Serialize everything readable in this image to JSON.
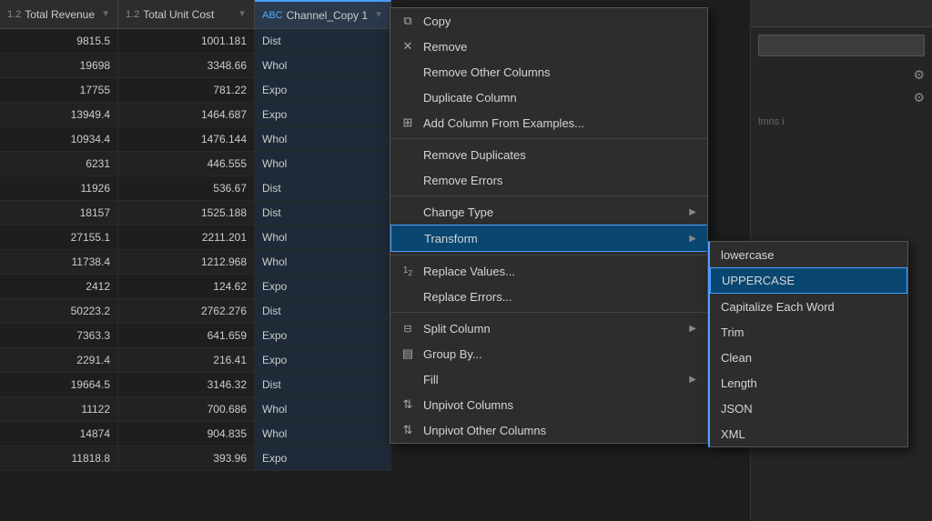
{
  "table": {
    "columns": [
      {
        "id": "revenue",
        "type": "1.2",
        "label": "Total Revenue",
        "icon": "▼"
      },
      {
        "id": "unitcost",
        "type": "1.2",
        "label": "Total Unit Cost",
        "icon": "▼"
      },
      {
        "id": "channel",
        "type": "ABC",
        "label": "Channel_Copy 1",
        "icon": "▼"
      }
    ],
    "rows": [
      {
        "revenue": "9815.5",
        "unitcost": "1001.181",
        "channel": "Dist"
      },
      {
        "revenue": "19698",
        "unitcost": "3348.66",
        "channel": "Whol"
      },
      {
        "revenue": "17755",
        "unitcost": "781.22",
        "channel": "Expo"
      },
      {
        "revenue": "13949.4",
        "unitcost": "1464.687",
        "channel": "Expo"
      },
      {
        "revenue": "10934.4",
        "unitcost": "1476.144",
        "channel": "Whol"
      },
      {
        "revenue": "6231",
        "unitcost": "446.555",
        "channel": "Whol"
      },
      {
        "revenue": "11926",
        "unitcost": "536.67",
        "channel": "Dist"
      },
      {
        "revenue": "18157",
        "unitcost": "1525.188",
        "channel": "Dist"
      },
      {
        "revenue": "27155.1",
        "unitcost": "2211.201",
        "channel": "Whol"
      },
      {
        "revenue": "11738.4",
        "unitcost": "1212.968",
        "channel": "Whol"
      },
      {
        "revenue": "2412",
        "unitcost": "124.62",
        "channel": "Expo"
      },
      {
        "revenue": "50223.2",
        "unitcost": "2762.276",
        "channel": "Dist"
      },
      {
        "revenue": "7363.3",
        "unitcost": "641.659",
        "channel": "Expo"
      },
      {
        "revenue": "2291.4",
        "unitcost": "216.41",
        "channel": "Expo"
      },
      {
        "revenue": "19664.5",
        "unitcost": "3146.32",
        "channel": "Dist"
      },
      {
        "revenue": "11122",
        "unitcost": "700.686",
        "channel": "Whol"
      },
      {
        "revenue": "14874",
        "unitcost": "904.835",
        "channel": "Whol"
      },
      {
        "revenue": "11818.8",
        "unitcost": "393.96",
        "channel": "Expo"
      }
    ]
  },
  "contextMenu": {
    "items": [
      {
        "id": "copy",
        "icon": "copy",
        "label": "Copy",
        "hasArrow": false,
        "hasSeparatorAfter": false
      },
      {
        "id": "remove",
        "icon": "remove",
        "label": "Remove",
        "hasArrow": false,
        "hasSeparatorAfter": false
      },
      {
        "id": "remove-other-columns",
        "icon": "",
        "label": "Remove Other Columns",
        "hasArrow": false,
        "hasSeparatorAfter": false
      },
      {
        "id": "duplicate-column",
        "icon": "",
        "label": "Duplicate Column",
        "hasArrow": false,
        "hasSeparatorAfter": false
      },
      {
        "id": "add-column-examples",
        "icon": "add-col",
        "label": "Add Column From Examples...",
        "hasArrow": false,
        "hasSeparatorAfter": true
      },
      {
        "id": "remove-duplicates",
        "icon": "",
        "label": "Remove Duplicates",
        "hasArrow": false,
        "hasSeparatorAfter": false
      },
      {
        "id": "remove-errors",
        "icon": "",
        "label": "Remove Errors",
        "hasArrow": false,
        "hasSeparatorAfter": true
      },
      {
        "id": "change-type",
        "icon": "",
        "label": "Change Type",
        "hasArrow": true,
        "hasSeparatorAfter": false
      },
      {
        "id": "transform",
        "icon": "",
        "label": "Transform",
        "hasArrow": true,
        "hasSeparatorAfter": true,
        "active": true
      },
      {
        "id": "replace-values",
        "icon": "replace",
        "label": "Replace Values...",
        "hasArrow": false,
        "hasSeparatorAfter": false
      },
      {
        "id": "replace-errors",
        "icon": "",
        "label": "Replace Errors...",
        "hasArrow": false,
        "hasSeparatorAfter": true
      },
      {
        "id": "split-column",
        "icon": "split",
        "label": "Split Column",
        "hasArrow": true,
        "hasSeparatorAfter": false
      },
      {
        "id": "group-by",
        "icon": "group",
        "label": "Group By...",
        "hasArrow": false,
        "hasSeparatorAfter": false
      },
      {
        "id": "fill",
        "icon": "",
        "label": "Fill",
        "hasArrow": true,
        "hasSeparatorAfter": false
      },
      {
        "id": "unpivot-columns",
        "icon": "unpivot",
        "label": "Unpivot Columns",
        "hasArrow": false,
        "hasSeparatorAfter": false
      },
      {
        "id": "unpivot-other-columns",
        "icon": "unpivot",
        "label": "Unpivot Other Columns",
        "hasArrow": false,
        "hasSeparatorAfter": false
      }
    ]
  },
  "submenu": {
    "items": [
      {
        "id": "lowercase",
        "label": "lowercase"
      },
      {
        "id": "uppercase",
        "label": "UPPERCASE",
        "selected": true
      },
      {
        "id": "capitalize",
        "label": "Capitalize Each Word"
      },
      {
        "id": "trim",
        "label": "Trim"
      },
      {
        "id": "clean",
        "label": "Clean"
      },
      {
        "id": "length",
        "label": "Length"
      },
      {
        "id": "json",
        "label": "JSON"
      },
      {
        "id": "xml",
        "label": "XML"
      }
    ]
  },
  "colors": {
    "accent": "#4a9eff",
    "activeMenu": "#094771",
    "menuBg": "#2d2d2d",
    "tableBg": "#1e1e1e",
    "headerBg": "#2d2d2d"
  }
}
